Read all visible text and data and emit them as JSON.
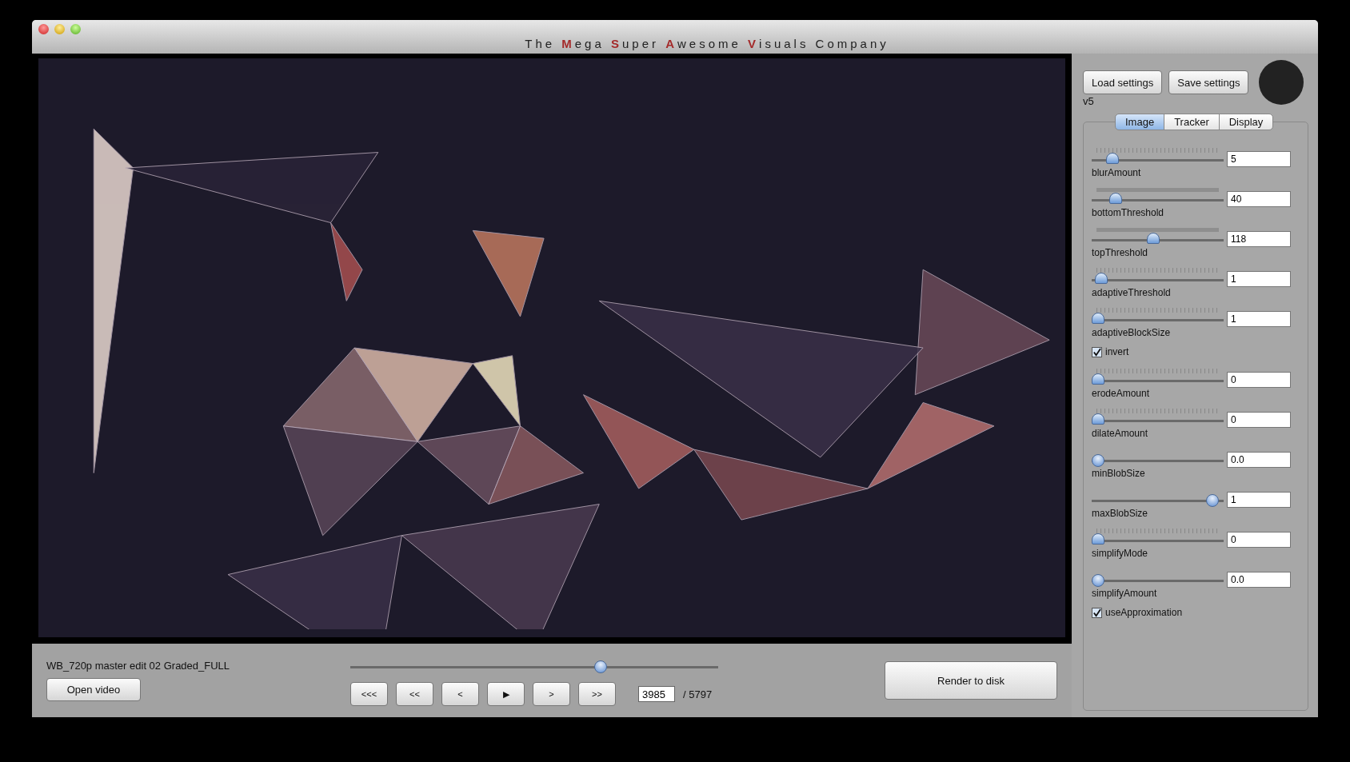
{
  "window": {
    "title": "The **M**ega **S**uper **A**wesome **V**isuals Company"
  },
  "settings_buttons": [
    "Load settings",
    "Save settings"
  ],
  "version": "v5",
  "tabs": [
    {
      "label": "Image",
      "selected": true
    },
    {
      "label": "Tracker",
      "selected": false
    },
    {
      "label": "Display",
      "selected": false
    }
  ],
  "controls": [
    {
      "kind": "tick-slider",
      "label": "blurAmount",
      "value": "5",
      "level": 0.12
    },
    {
      "kind": "bar-slider",
      "label": "bottomThreshold",
      "value": "40",
      "level": 0.15
    },
    {
      "kind": "bar-slider",
      "label": "topThreshold",
      "value": "118",
      "level": 0.46
    },
    {
      "kind": "tick-slider",
      "label": "adaptiveThreshold",
      "value": "1",
      "level": 0.03
    },
    {
      "kind": "tick-slider",
      "label": "adaptiveBlockSize",
      "value": "1",
      "level": 0
    },
    {
      "kind": "checkbox",
      "label": "invert",
      "checked": true
    },
    {
      "kind": "tick-slider",
      "label": "erodeAmount",
      "value": "0",
      "level": 0
    },
    {
      "kind": "tick-slider",
      "label": "dilateAmount",
      "value": "0",
      "level": 0
    },
    {
      "kind": "slider",
      "label": "minBlobSize",
      "value": "0.0",
      "level": 0
    },
    {
      "kind": "slider",
      "label": "maxBlobSize",
      "value": "1",
      "level": 0.96
    },
    {
      "kind": "tick-slider",
      "label": "simplifyMode",
      "value": "0",
      "level": 0
    },
    {
      "kind": "slider",
      "label": "simplifyAmount",
      "value": "0.0",
      "level": 0
    },
    {
      "kind": "checkbox",
      "label": "useApproximation",
      "checked": true
    }
  ],
  "player": {
    "file_name": "WB_720p master edit 02 Graded_FULL",
    "open_button": "Open video",
    "level": 0.68,
    "transport": [
      "<<<",
      "<<",
      "<",
      "▶",
      ">",
      ">>"
    ],
    "frame": "3985",
    "total": "/ 5797",
    "render_button": "Render to disk"
  }
}
